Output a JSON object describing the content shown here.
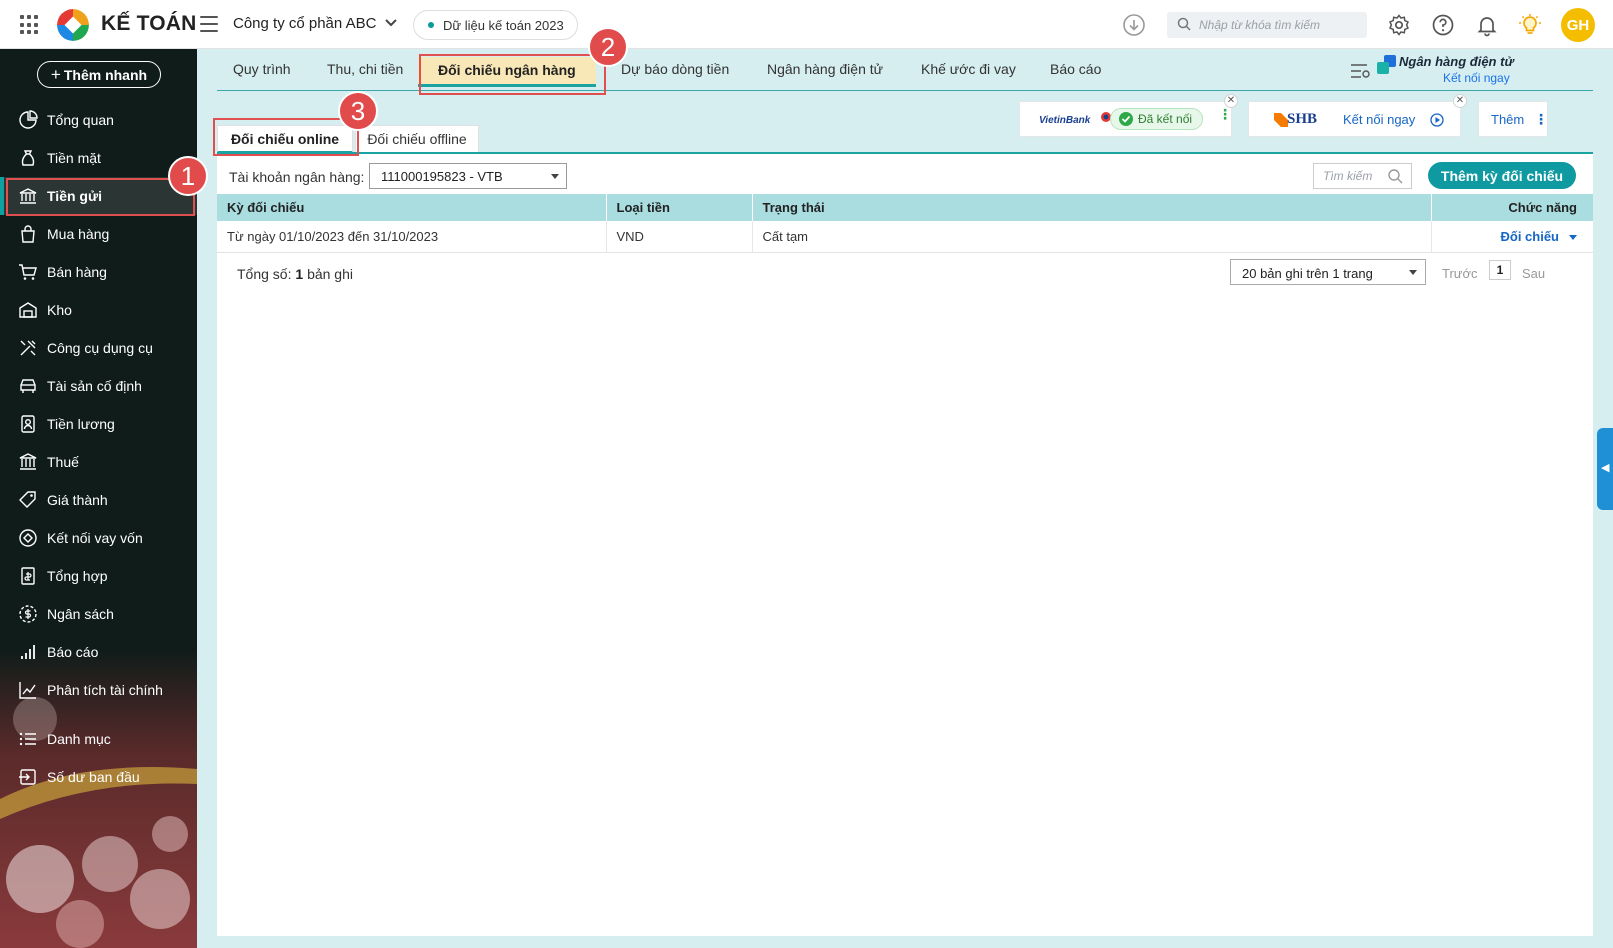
{
  "header": {
    "brand": "KẾ TOÁN",
    "company": "Công ty cổ phần ABC",
    "data_scope": "Dữ liệu kế toán 2023",
    "search_placeholder": "Nhập từ khóa tìm kiếm",
    "avatar_initials": "GH"
  },
  "sidebar": {
    "quick_add": "Thêm nhanh",
    "items": [
      {
        "label": "Tổng quan",
        "icon": "dashboard-icon"
      },
      {
        "label": "Tiền mặt",
        "icon": "cash-bag-icon"
      },
      {
        "label": "Tiền gửi",
        "icon": "bank-icon",
        "active": true
      },
      {
        "label": "Mua hàng",
        "icon": "shopping-bag-icon"
      },
      {
        "label": "Bán hàng",
        "icon": "cart-icon"
      },
      {
        "label": "Kho",
        "icon": "warehouse-icon"
      },
      {
        "label": "Công cụ dụng cụ",
        "icon": "tools-icon"
      },
      {
        "label": "Tài sản cố định",
        "icon": "car-icon"
      },
      {
        "label": "Tiền lương",
        "icon": "payroll-icon"
      },
      {
        "label": "Thuế",
        "icon": "tax-building-icon"
      },
      {
        "label": "Giá thành",
        "icon": "price-tag-icon"
      },
      {
        "label": "Kết nối vay vốn",
        "icon": "loan-link-icon"
      },
      {
        "label": "Tổng hợp",
        "icon": "summary-doc-icon"
      },
      {
        "label": "Ngân sách",
        "icon": "budget-icon"
      },
      {
        "label": "Báo cáo",
        "icon": "bar-chart-icon"
      },
      {
        "label": "Phân tích tài chính",
        "icon": "line-chart-icon"
      },
      {
        "label": "Danh mục",
        "icon": "list-icon"
      },
      {
        "label": "Số dư ban đầu",
        "icon": "opening-balance-icon"
      }
    ]
  },
  "tabs": [
    {
      "label": "Quy trình"
    },
    {
      "label": "Thu, chi tiền"
    },
    {
      "label": "Đối chiếu ngân hàng",
      "active": true
    },
    {
      "label": "Dự báo dòng tiền"
    },
    {
      "label": "Ngân hàng điện tử"
    },
    {
      "label": "Khế ước đi vay"
    },
    {
      "label": "Báo cáo"
    }
  ],
  "ebank": {
    "title": "Ngân hàng điện tử",
    "link": "Kết nối ngay"
  },
  "bank_cards": {
    "vietinbank": {
      "name": "VietinBank",
      "status": "Đã kết nối"
    },
    "shb": {
      "name": "SHB",
      "action": "Kết nối ngay"
    },
    "more": "Thêm"
  },
  "subtabs": [
    {
      "label": "Đối chiếu online",
      "active": true
    },
    {
      "label": "Đối chiếu offline"
    }
  ],
  "toolbar": {
    "account_label": "Tài khoản ngân hàng:",
    "account_value": "111000195823 - VTB",
    "search_placeholder": "Tìm kiếm",
    "add_button": "Thêm kỳ đối chiếu"
  },
  "table": {
    "columns": [
      "Kỳ đối chiếu",
      "Loại tiền",
      "Trạng thái",
      "Chức năng"
    ],
    "rows": [
      {
        "period": "Từ ngày 01/10/2023 đến 31/10/2023",
        "currency": "VND",
        "status": "Cất tạm",
        "action": "Đối chiếu"
      }
    ]
  },
  "footer": {
    "total_prefix": "Tổng số:",
    "total_count": "1",
    "total_suffix": "bản ghi",
    "page_size": "20 bản ghi trên 1 trang",
    "prev": "Trước",
    "page": "1",
    "next": "Sau"
  },
  "annotations": {
    "step1": "1",
    "step2": "2",
    "step3": "3"
  },
  "colors": {
    "accent": "#0e9aa0",
    "sidebar_bg": "#0f1c1a",
    "active_tab_bg": "#f8e7b7",
    "annotation": "#e14b4b"
  }
}
